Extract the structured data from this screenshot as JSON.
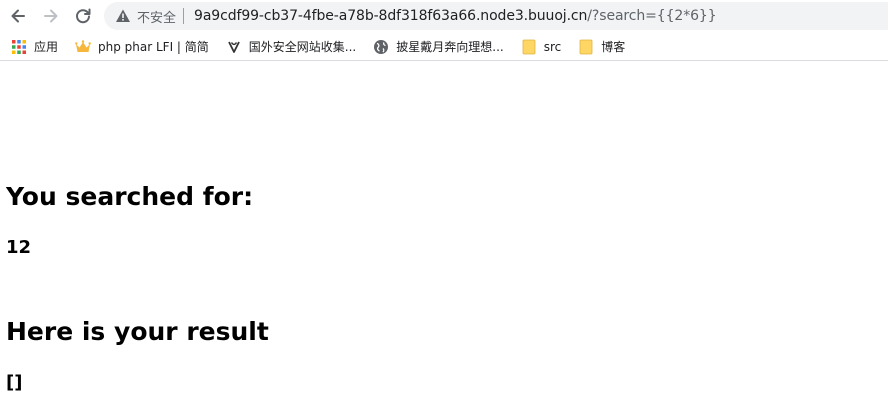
{
  "browser": {
    "nav": {
      "back_icon": "arrow-left-icon",
      "forward_icon": "arrow-right-icon",
      "reload_icon": "reload-icon"
    },
    "omnibox": {
      "security_icon": "warning-triangle-icon",
      "security_label": "不安全",
      "url_host": "9a9cdf99-cb37-4fbe-a78b-8df318f63a66.node3.buuoj.cn",
      "url_path": "/?search={{2*6}}"
    },
    "bookmarks": [
      {
        "label": "应用",
        "icon": "apps-grid-icon"
      },
      {
        "label": "php phar LFI | 简简",
        "icon": "crown-icon"
      },
      {
        "label": "国外安全网站收集...",
        "icon": "site-favicon-icon"
      },
      {
        "label": "披星戴月奔向理想...",
        "icon": "globe-icon"
      },
      {
        "label": "src",
        "icon": "folder-icon"
      },
      {
        "label": "博客",
        "icon": "folder-icon"
      }
    ],
    "colors": {
      "omnibox_bg": "#f1f3f4",
      "folder_yellow": "#fdd663",
      "text_dim": "#5f6368"
    }
  },
  "page": {
    "searched_heading": "You searched for:",
    "searched_value": "12",
    "result_heading": "Here is your result",
    "result_value": "[]"
  }
}
